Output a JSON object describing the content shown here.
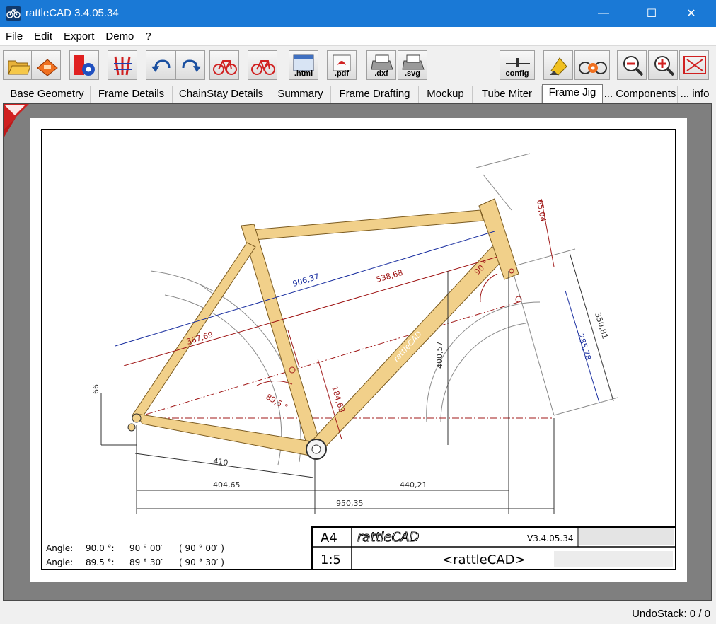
{
  "window": {
    "title": "rattleCAD  3.4.05.34",
    "minimize": "—",
    "maximize": "☐",
    "close": "✕"
  },
  "menu": {
    "items": [
      {
        "label": "File"
      },
      {
        "label": "Edit"
      },
      {
        "label": "Export"
      },
      {
        "label": "Demo"
      },
      {
        "label": "?"
      }
    ]
  },
  "toolbar": {
    "open": "open-folder-icon",
    "save": "save-icon",
    "settings": "frame-settings-icon",
    "geometry": "geometry-icon",
    "undo": "undo-icon",
    "redo": "redo-icon",
    "bike_red_a": "bike-icon",
    "bike_red_b": "bike-icon",
    "html_label": ".html",
    "pdf_label": ".pdf",
    "dxf_label": ".dxf",
    "svg_label": ".svg",
    "config_label": "config",
    "render": "render-icon",
    "bike_config": "bike-config-icon",
    "zoom_out": "zoom-out-icon",
    "zoom_in": "zoom-in-icon",
    "fit": "fit-screen-icon"
  },
  "tabs": [
    {
      "label": "Base Geometry",
      "active": false
    },
    {
      "label": "Frame Details",
      "active": false
    },
    {
      "label": "ChainStay Details",
      "active": false
    },
    {
      "label": "Summary",
      "active": false
    },
    {
      "label": "Frame Drafting",
      "active": false
    },
    {
      "label": "Mockup",
      "active": false
    },
    {
      "label": "Tube Miter",
      "active": false
    },
    {
      "label": "Frame Jig",
      "active": true
    },
    {
      "label": "... Components",
      "active": false
    },
    {
      "label": "... info",
      "active": false
    }
  ],
  "drawing": {
    "dimensions": {
      "d906": "906,37",
      "d538": "538,68",
      "d367": "367,69",
      "d184": "184,63",
      "d89_5": "89,5 °",
      "d90": "90 °",
      "d65": "65,04",
      "d350": "350,81",
      "d285": "285,78",
      "d400": "400,57",
      "d66": "66",
      "d410": "410",
      "d404": "404,65",
      "d440": "440,21",
      "d950": "950,35"
    },
    "angle_table": [
      {
        "label": "Angle:",
        "deg": "90.0  °:",
        "dms": "90 ° 00′",
        "paren": "( 90 ° 00′ )"
      },
      {
        "label": "Angle:",
        "deg": "89.5  °:",
        "dms": "89 ° 30′",
        "paren": "( 90 ° 30′ )"
      }
    ],
    "title_block": {
      "format": "A4",
      "scale": "1:5",
      "logo": "rattleCAD",
      "version": "V3.4.05.34",
      "name": "<rattleCAD>"
    }
  },
  "status": {
    "undo": "UndoStack:  0 /  0"
  }
}
